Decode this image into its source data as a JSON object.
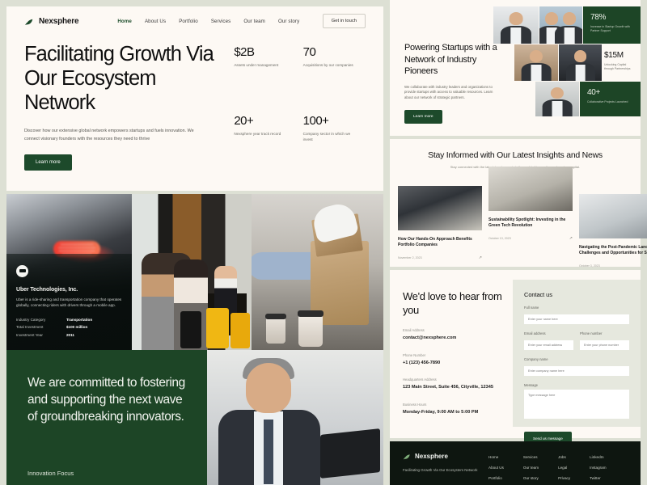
{
  "brand": {
    "name": "Nexsphere",
    "logo_icon": "leaf-icon"
  },
  "nav": {
    "links": [
      {
        "label": "Home",
        "active": true
      },
      {
        "label": "About Us",
        "active": false
      },
      {
        "label": "Portfolio",
        "active": false
      },
      {
        "label": "Services",
        "active": false
      },
      {
        "label": "Our team",
        "active": false
      },
      {
        "label": "Our story",
        "active": false
      }
    ],
    "cta": "Get in touch"
  },
  "hero": {
    "title": "Facilitating Growth Via Our Ecosystem Network",
    "subtitle": "Discover how our extensive global network empowers startups and fuels innovation.  We connect visionary founders with the resources they need to thrive",
    "button": "Learn more",
    "stats": [
      {
        "value": "$2B",
        "label": "Assets under management"
      },
      {
        "value": "70",
        "label": "Acquisitions by our companies"
      },
      {
        "value": "20+",
        "label": "Nexsphere year track record"
      },
      {
        "value": "100+",
        "label": "Company sector in which we invest"
      }
    ]
  },
  "portfolio_card": {
    "logo_icon": "uber-logo-icon",
    "company": "Uber Technologies, Inc.",
    "description": "Uber is a ride-sharing and transportation company that operates globally, connecting riders with drivers through a mobile app.",
    "rows": [
      {
        "key": "Industry Category",
        "value": "Transportation"
      },
      {
        "key": "Total Investment",
        "value": "$100 million"
      },
      {
        "key": "Investment Year",
        "value": "2011"
      }
    ]
  },
  "commitment": {
    "headline": "We are committed to fostering and supporting the next wave of groundbreaking innovators.",
    "tag": "Innovation Focus"
  },
  "powering": {
    "title": "Powering Startups with a Network of Industry Pioneers",
    "paragraph": "We collaborate with industry leaders and organizations to provide startups with access to valuable resources. Learn about our network of strategic partners.",
    "button": "Learn more",
    "stats": [
      {
        "value": "78%",
        "label": "Increase in Startup Growth with Partner Support"
      },
      {
        "value": "$15M",
        "label": "Unlocking Capital through Partnerships"
      },
      {
        "value": "40+",
        "label": "Collaborative Projects Launched"
      }
    ]
  },
  "insights": {
    "title": "Stay Informed with Our Latest Insights and News",
    "subtitle": "Stay connected with the latest developments in the world of innovation and venture capital.",
    "cards": [
      {
        "title": "How Our Hands-On Approach Benefits Portfolio Companies",
        "date": "November 2, 2023",
        "arrow": "↗"
      },
      {
        "title": "Sustainability Spotlight: Investing in the Green Tech Revolution",
        "date": "October 13, 2023",
        "arrow": "↗"
      },
      {
        "title": "Navigating the Post-Pandemic Landscape: Challenges and Opportunities for Startups",
        "date": "October 3, 2023",
        "arrow": "↗"
      }
    ]
  },
  "contact": {
    "headline": "We'd love to hear from you",
    "details": [
      {
        "key": "Email Address",
        "value": "contact@nexsphere.com"
      },
      {
        "key": "Phone Number",
        "value": "+1 (123) 456-7890"
      },
      {
        "key": "Headquarters Address",
        "value": "123 Main Street, Suite 456, Cityville, 12345"
      },
      {
        "key": "Business Hours",
        "value": "Monday-Friday, 9:00 AM to 5:00 PM"
      }
    ],
    "form": {
      "title": "Contact us",
      "full_name_label": "Full name",
      "full_name_placeholder": "Enter your name here",
      "email_label": "Email address",
      "email_placeholder": "Enter your email address",
      "phone_label": "Phone number",
      "phone_placeholder": "Enter your phone number",
      "company_label": "Company name",
      "company_placeholder": "Enter company name here",
      "message_label": "Message",
      "message_placeholder": "Type message here",
      "submit": "Send us message"
    }
  },
  "footer": {
    "brand": "Nexsphere",
    "tagline": "Facilitating Growth Via Our Ecosystem Network",
    "columns": [
      {
        "links": [
          "Home",
          "About Us",
          "Portfolio"
        ]
      },
      {
        "links": [
          "Services",
          "Our team",
          "Our story"
        ]
      },
      {
        "links": [
          "Jobs",
          "Legal",
          "Privacy"
        ]
      },
      {
        "links": [
          "LinkedIn",
          "Instagram",
          "Twitter"
        ]
      }
    ]
  },
  "colors": {
    "accent_green": "#1d4a2b",
    "dark_green": "#1d4526",
    "page_bg": "#dde0d4",
    "cream": "#fdf9f4",
    "footer_bg": "#0e1610"
  }
}
